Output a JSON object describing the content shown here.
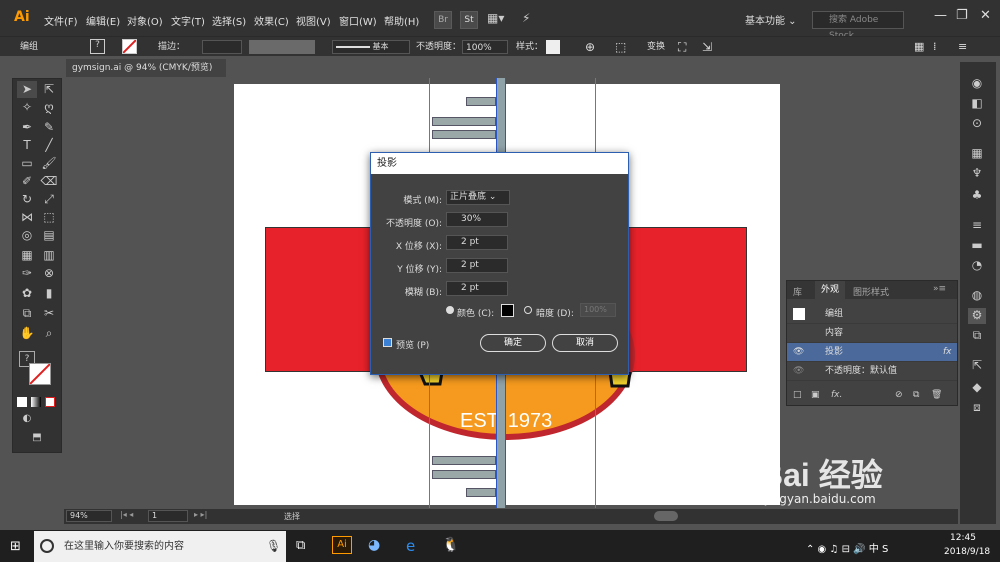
{
  "app": {
    "logo": "Ai",
    "menus": [
      "文件(F)",
      "编辑(E)",
      "对象(O)",
      "文字(T)",
      "选择(S)",
      "效果(C)",
      "视图(V)",
      "窗口(W)",
      "帮助(H)"
    ],
    "bridge_label": "Br",
    "stock_label": "St",
    "workspace": "基本功能",
    "stock_search_placeholder": "搜索 Adobe Stock"
  },
  "control_bar": {
    "selection": "编组",
    "stroke_label": "描边：",
    "stroke_profile": "基本",
    "opacity_label": "不透明度：",
    "opacity_value": "100%",
    "style_label": "样式：",
    "transform_label": "变换"
  },
  "document": {
    "tab_title": "gymsign.ai @ 94% (CMYK/预览)",
    "zoom": "94%",
    "artboard_number": "1",
    "status_tool": "选择",
    "logo_text": "EST. 1973"
  },
  "dialog": {
    "title": "投影",
    "mode_label": "模式 (M):",
    "mode_value": "正片叠底",
    "opacity_label": "不透明度 (O):",
    "opacity_value": "30%",
    "x_offset_label": "X 位移 (X):",
    "x_offset_value": "2 pt",
    "y_offset_label": "Y 位移 (Y):",
    "y_offset_value": "2 pt",
    "blur_label": "模糊 (B):",
    "blur_value": "2 pt",
    "color_label": "颜色 (C):",
    "darkness_label": "暗度 (D):",
    "darkness_value": "100%",
    "preview_label": "预览 (P)",
    "ok_label": "确定",
    "cancel_label": "取消"
  },
  "appearance_panel": {
    "tabs": [
      "库",
      "外观",
      "图形样式"
    ],
    "rows": [
      "编组",
      "内容",
      "投影",
      "不透明度：默认值"
    ],
    "fx_label": "fx"
  },
  "taskbar": {
    "search_placeholder": "在这里输入你要搜索的内容",
    "time": "12:45",
    "date": "2018/9/18",
    "app_label": "Ai"
  },
  "watermark": {
    "brand": "Bai 经验",
    "url": "jingyan.baidu.com"
  }
}
